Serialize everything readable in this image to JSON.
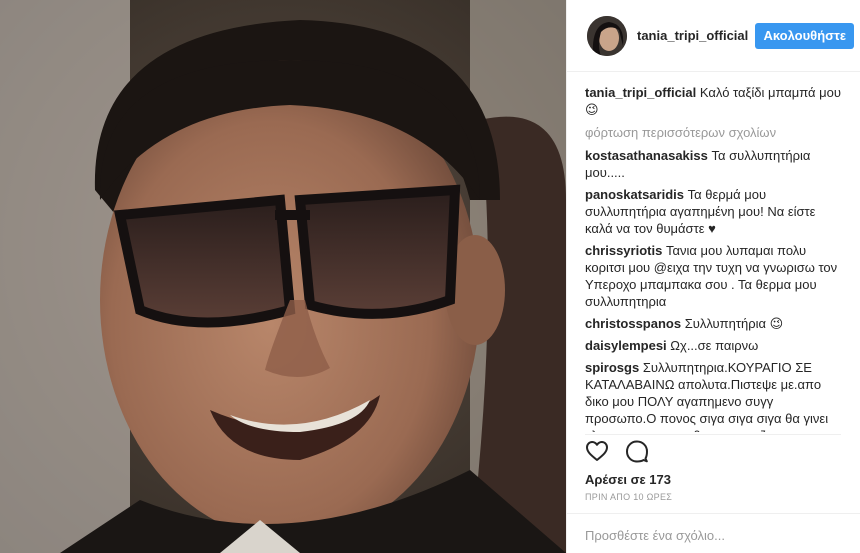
{
  "post": {
    "owner": "tania_tripi_official",
    "follow_label": "Ακολουθήστε",
    "caption_user": "tania_tripi_official",
    "caption_text": "Καλό ταξίδι μπαμπά μου 😉",
    "load_more_label": "φόρτωση περισσότερων σχολίων",
    "likes_text": "Αρέσει σε 173",
    "timestamp": "ΠΡΙΝ ΑΠΟ 10 ΩΡΕΣ",
    "add_comment_placeholder": "Προσθέστε ένα σχόλιο..."
  },
  "comments": [
    {
      "user": "kostasathanasakiss",
      "text": "Τα συλλυπητήρια μου....."
    },
    {
      "user": "panoskatsaridis",
      "text": "Τα θερμά μου συλλυπητήρια αγαπημένη μου! Να είστε καλά να τον θυμάστε ♥"
    },
    {
      "user": "chrissyriotis",
      "text": "Τανια μου λυπαμαι πολυ κοριτσι μου @ειχα την τυχη να γνωρισω τον Υπεροχο μπαμπακα σου . Τα θερμα μου συλλυπητηρια"
    },
    {
      "user": "christosspanos",
      "text": "Συλλυπητήρια 😉"
    },
    {
      "user": "daisylempesi",
      "text": "Ωχ...σε παιρνω"
    },
    {
      "user": "spirosgs",
      "text": "Συλλυπητηρια.ΚΟΥΡΑΓΙΟ ΣΕ ΚΑΤΑΛΑΒΑΙΝΩ απολυτα.Πιστεψε με.απο δικο μου ΠΟΛΥ αγαπημενο συγγ προσωπο.Ο πονος σιγα σιγα σιγα θα γινει γλυκια αγαπη που θα σε στηριζει."
    }
  ],
  "icons": {
    "like": "heart-icon",
    "comment": "comment-bubble-icon"
  },
  "colors": {
    "follow_button": "#3897f0",
    "secondary_text": "#999999",
    "primary_text": "#262626"
  }
}
